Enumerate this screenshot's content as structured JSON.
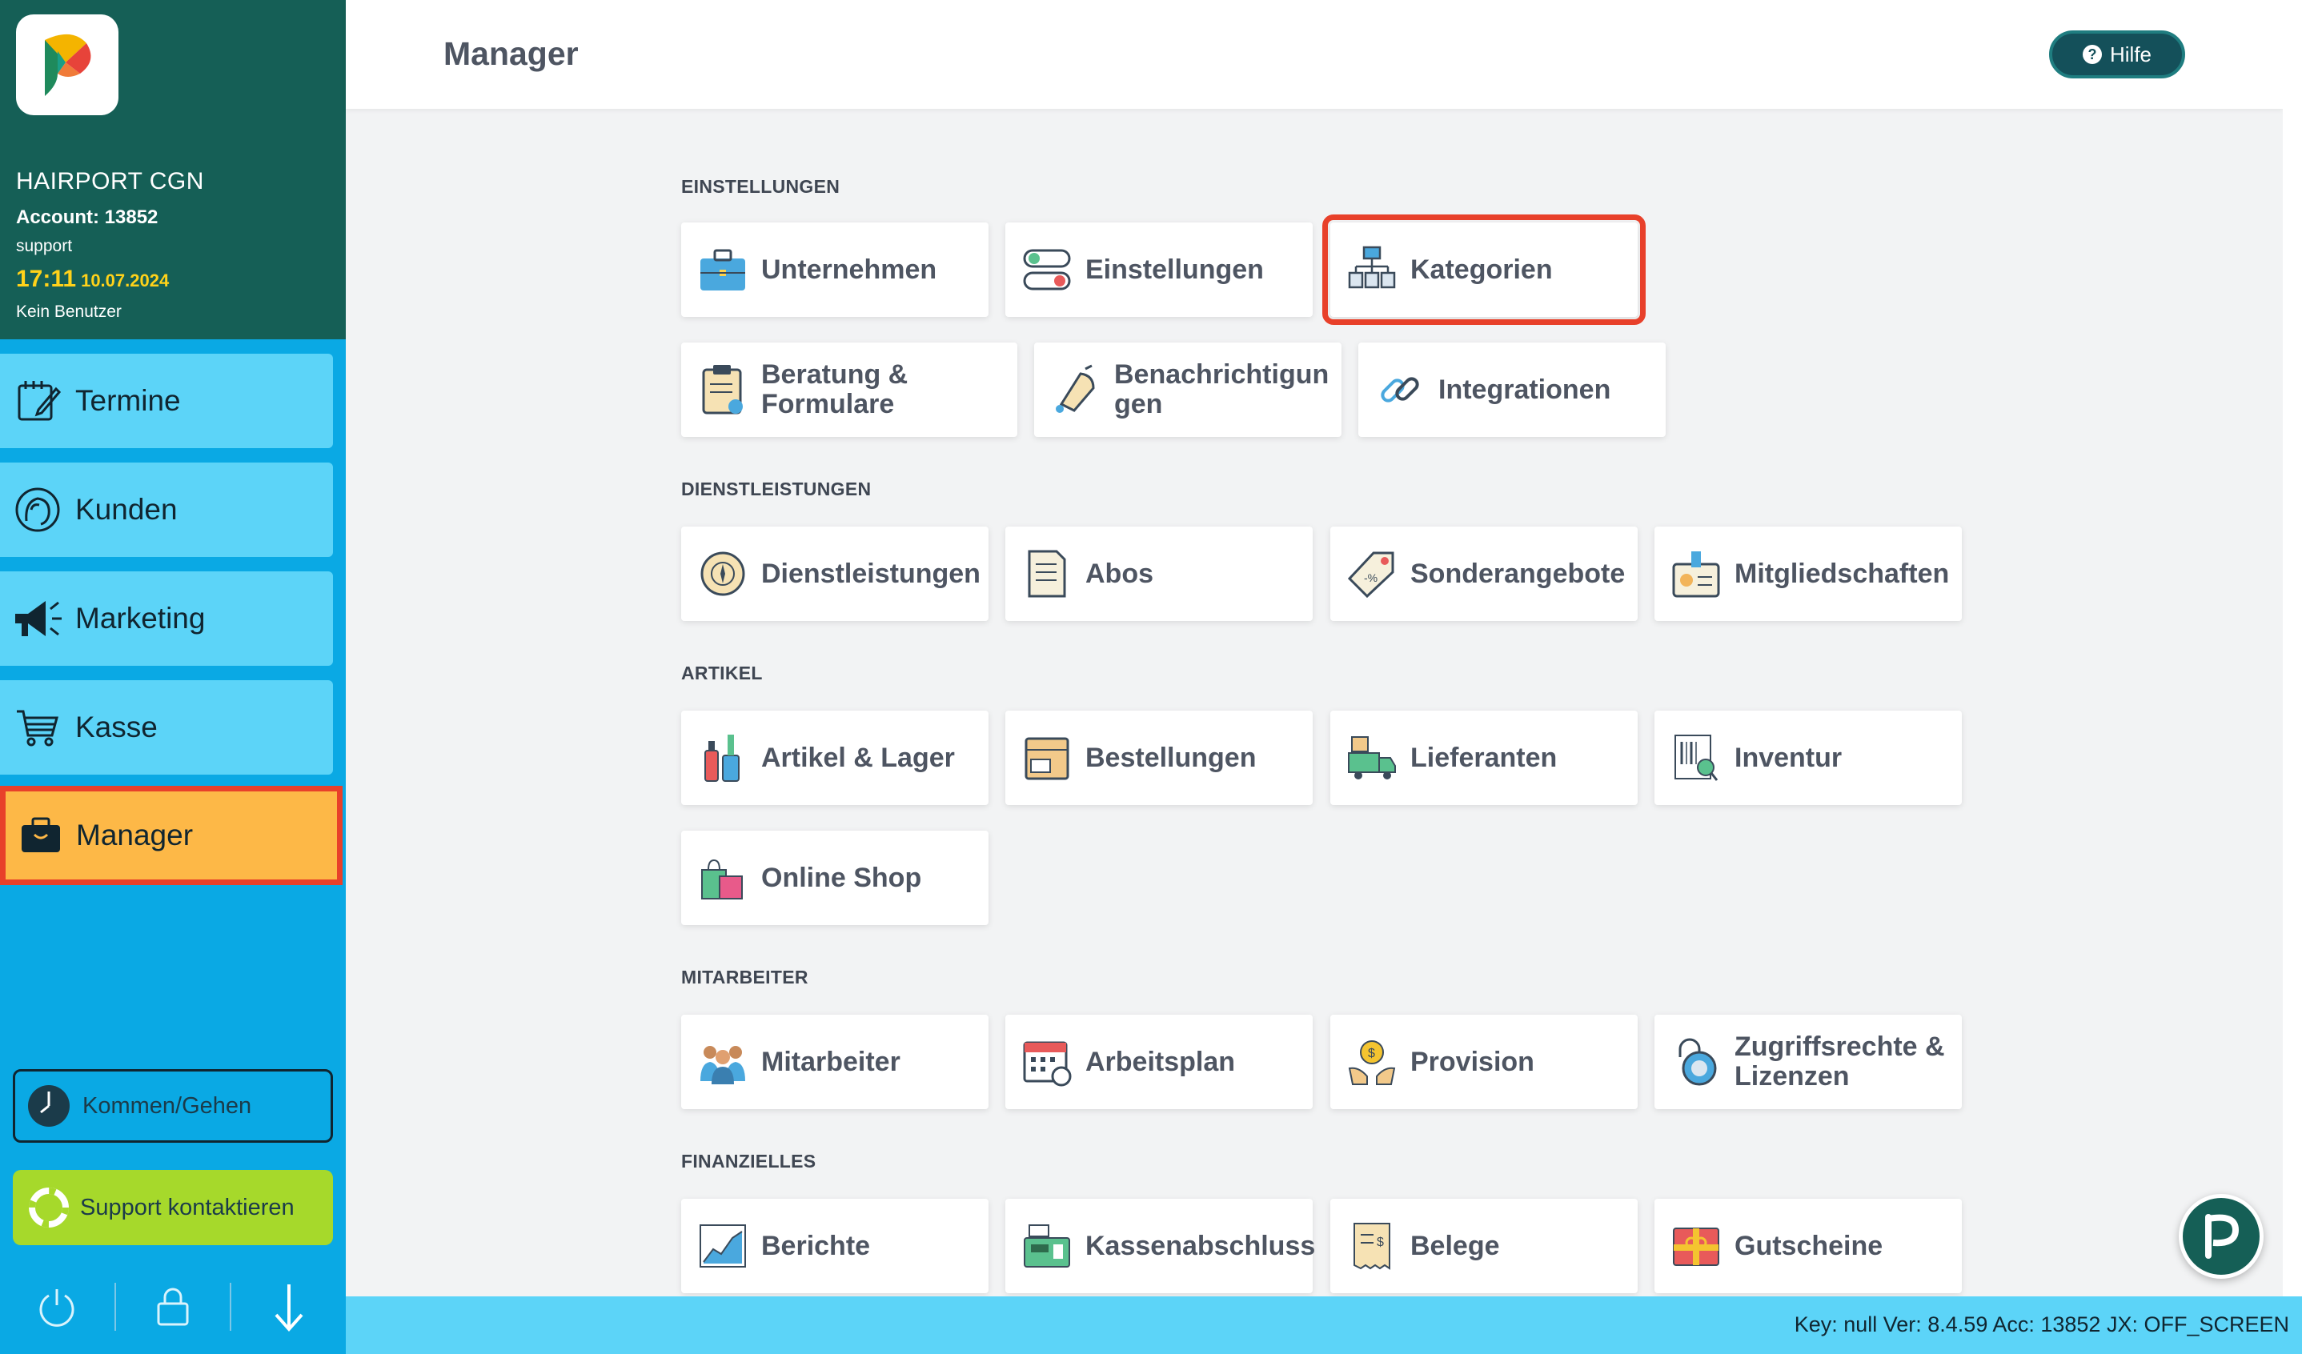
{
  "sidebar": {
    "salon_name": "HAIRPORT CGN",
    "account": "Account: 13852",
    "user": "support",
    "time": "17:11",
    "date": "10.07.2024",
    "no_user": "Kein Benutzer",
    "nav": {
      "termine": "Termine",
      "kunden": "Kunden",
      "marketing": "Marketing",
      "kasse": "Kasse",
      "manager": "Manager"
    },
    "clock_in_out": "Kommen/Gehen",
    "support": "Support kontaktieren"
  },
  "header": {
    "title": "Manager",
    "help": "Hilfe"
  },
  "sections": {
    "einstellungen": {
      "title": "EINSTELLUNGEN",
      "unternehmen": "Unternehmen",
      "einstellungen": "Einstellungen",
      "kategorien": "Kategorien",
      "beratung": "Beratung & Formulare",
      "benachrichtigungen": "Benachrichtigun gen",
      "integrationen": "Integrationen"
    },
    "dienstleistungen": {
      "title": "DIENSTLEISTUNGEN",
      "dienstleistungen": "Dienstleistungen",
      "abos": "Abos",
      "sonderangebote": "Sonderangebote",
      "mitgliedschaften": "Mitgliedschaften"
    },
    "artikel": {
      "title": "ARTIKEL",
      "artikel_lager": "Artikel & Lager",
      "bestellungen": "Bestellungen",
      "lieferanten": "Lieferanten",
      "inventur": "Inventur",
      "online_shop": "Online Shop"
    },
    "mitarbeiter": {
      "title": "MITARBEITER",
      "mitarbeiter": "Mitarbeiter",
      "arbeitsplan": "Arbeitsplan",
      "provision": "Provision",
      "zugriffsrechte": "Zugriffsrechte & Lizenzen"
    },
    "finanzielles": {
      "title": "FINANZIELLES",
      "berichte": "Berichte",
      "kassenabschluss": "Kassenabschluss",
      "belege": "Belege",
      "gutscheine": "Gutscheine"
    }
  },
  "footer": {
    "status": "Key: null Ver: 8.4.59 Acc: 13852  JX: OFF_SCREEN"
  },
  "colors": {
    "sidebar_header": "#155f56",
    "sidebar_bg": "#0aa9e4",
    "nav_item": "#5cd4f8",
    "nav_active": "#fdb847",
    "highlight": "#e8402a",
    "clock_yellow": "#ffd21a",
    "support_green": "#a6d92b"
  }
}
